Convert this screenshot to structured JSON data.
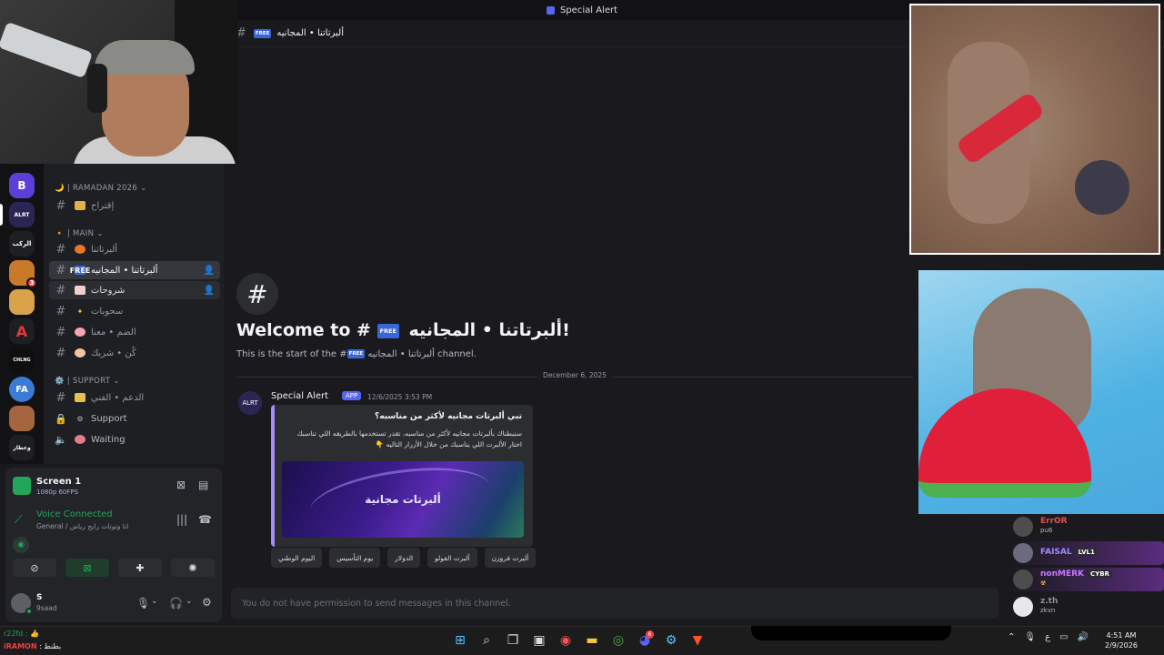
{
  "titlebar": {
    "title": "Special Alert"
  },
  "servers": [
    {
      "label": "B",
      "color": "#5b3fd8"
    },
    {
      "label": "ALRT",
      "color": "#2a2553"
    },
    {
      "label": "الركب",
      "color": "#1e1f22"
    },
    {
      "label": "3",
      "color": "#c8792a",
      "badge": "3"
    },
    {
      "label": "",
      "color": "#d9a24a"
    },
    {
      "label": "A",
      "color": "#1e1f22"
    },
    {
      "label": "CHLNG",
      "color": "#0f0f0f"
    },
    {
      "label": "FA",
      "color": "#3a7bd5"
    },
    {
      "label": "",
      "color": "#a5663f"
    },
    {
      "label": "وعطار",
      "color": "#1e1f22"
    }
  ],
  "sidebar": {
    "categories": {
      "ramadan": "🌙 | RAMADAN 2026",
      "main": "🔸 | MAIN",
      "support": "⚙️ | SUPPORT"
    },
    "channels": {
      "suggest": "إقتراح",
      "orbits": "ألبرتاتنا",
      "free": "ألبرتاتنا • المجانيه",
      "explain": "شروحات",
      "draws": "سحوبات",
      "dsm": "الضم • معنا",
      "partner": "كُن • شريك",
      "techsupport": "الدعم • الفني",
      "support": "Support",
      "waiting": "Waiting"
    }
  },
  "panel": {
    "screen_title": "Screen 1",
    "screen_sub": "1080p 60FPS",
    "voice_title": "Voice Connected",
    "voice_sub": "General / انا وتوتات رايح رياض",
    "user_name": "S",
    "user_status": "9saad"
  },
  "main": {
    "channel_header": "ألبرتاتنا • المجانيه",
    "free_tag": "FREE",
    "welcome_title_prefix": "Welcome to #",
    "welcome_title_name": "ألبرتاتنا • المجانيه!",
    "welcome_sub_prefix": "This is the start of the #",
    "welcome_sub_name": "ألبرتاتنا • المجانيه",
    "welcome_sub_suffix": "channel.",
    "date_divider": "December 6, 2025",
    "message": {
      "author": "Special Alert",
      "app_tag": "APP",
      "timestamp": "12/6/2025 3:53 PM",
      "embed_title": "تبي ألبرتات مجانيه لأكثر من مناسبه؟",
      "embed_desc_1": "سنبطناك بألبرتات مجانيه لأكثر من مناسبه، تقدر تستخدمها بالطريقه اللي تناسبك",
      "embed_desc_2": "اختار الألبرت اللي يناسبك من خلال الأزرار التاليه 👇",
      "embed_image_text": "ألبرتات مجانية"
    },
    "buttons": [
      "اليوم الوطني",
      "يوم التأسيس",
      "الدولار",
      "ألبرت الفولو",
      "ألبرت فروزن"
    ],
    "input_placeholder": "You do not have permission to send messages in this channel."
  },
  "chat_overlay": [
    {
      "name": "ErrOR",
      "color": "#e05252",
      "msg": "pu6",
      "tag": ""
    },
    {
      "name": "FAISAL",
      "color": "#9b8cff",
      "msg": "",
      "tag": "LVL1"
    },
    {
      "name": "nonMERK",
      "color": "#c978ff",
      "msg": "☢",
      "tag": "CYBR"
    },
    {
      "name": "z.th",
      "color": "#8f8f8f",
      "msg": "zkvn",
      "tag": ""
    }
  ],
  "taskbar": {
    "line1": "r22fd : 👍",
    "line2_red": "iRAMON",
    "line2": ": بطنط",
    "time": "4:51 AM",
    "date": "2/9/2026",
    "lang": "ع"
  },
  "colors": {
    "accent": "#5865f2",
    "online": "#23a55a",
    "bg": "#1a1a1e"
  }
}
